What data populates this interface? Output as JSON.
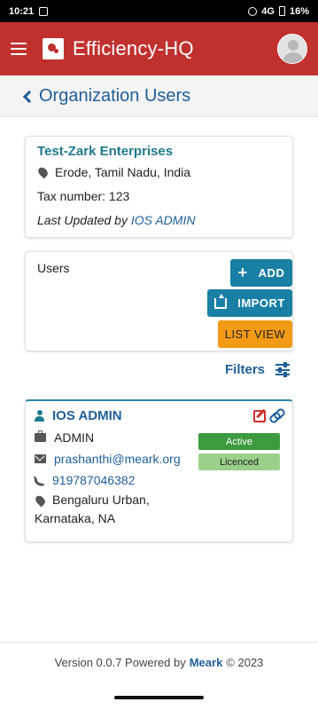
{
  "status_bar": {
    "time": "10:21",
    "network": "4G",
    "battery": "16%"
  },
  "app_bar": {
    "title": "Efficiency-HQ"
  },
  "page": {
    "title": "Organization Users"
  },
  "organization": {
    "name": "Test-Zark Enterprises",
    "location": "Erode, Tamil Nadu, India",
    "tax_text": "Tax number: 123",
    "updated_prefix": "Last Updated by",
    "updated_by": "IOS ADMIN"
  },
  "users_panel": {
    "label": "Users",
    "add_label": "ADD",
    "import_label": "IMPORT",
    "list_view_label": "LIST VIEW"
  },
  "filters": {
    "label": "Filters"
  },
  "user": {
    "name": "IOS ADMIN",
    "role": "ADMIN",
    "email": "prashanthi@meark.org",
    "phone": "919787046382",
    "address_line1": "Bengaluru Urban,",
    "address_line2": "Karnataka, NA",
    "status": "Active",
    "license": "Licenced"
  },
  "footer": {
    "prefix": "Version 0.0.7 Powered by",
    "brand": "Meark",
    "suffix": "© 2023"
  },
  "colors": {
    "app_bar": "#c0312e",
    "primary_link": "#1f5f9a",
    "button_blue": "#1a7fa4",
    "button_orange": "#f39a16",
    "active_green": "#3c9a3f",
    "licenced_green": "#9bd08a"
  }
}
